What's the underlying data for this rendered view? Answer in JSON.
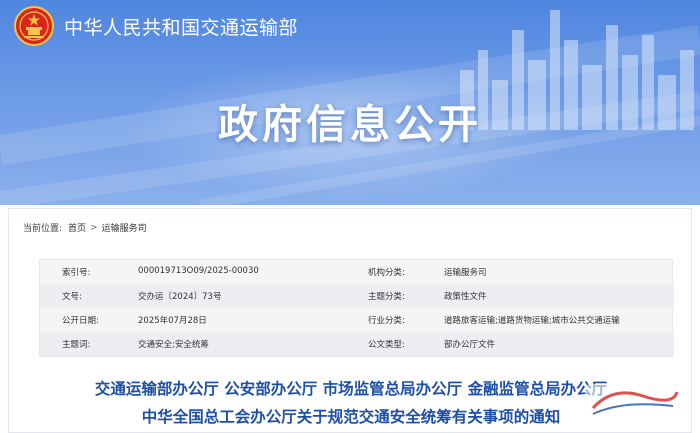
{
  "header": {
    "ministry_name": "中华人民共和国交通运输部",
    "portal_title": "政府信息公开"
  },
  "breadcrumb": {
    "prefix": "当前位置:",
    "items": [
      "首页",
      "运输服务司"
    ],
    "separator": ">"
  },
  "metadata": [
    {
      "label": "索引号:",
      "value": "000019713O09/2025-00030",
      "label2": "机构分类:",
      "value2": "运输服务司"
    },
    {
      "label": "文号:",
      "value": "交办运〔2024〕73号",
      "label2": "主题分类:",
      "value2": "政策性文件"
    },
    {
      "label": "公开日期:",
      "value": "2025年07月28日",
      "label2": "行业分类:",
      "value2": "道路旅客运输;道路货物运输;城市公共交通运输"
    },
    {
      "label": "主题词:",
      "value": "交通安全;安全统筹",
      "label2": "公文类型:",
      "value2": "部办公厅文件"
    }
  ],
  "document": {
    "title_line1": "交通运输部办公厅 公安部办公厅 市场监管总局办公厅 金融监管总局办公厅",
    "title_line2": "中华全国总工会办公厅关于规范交通安全统筹有关事项的通知"
  },
  "colors": {
    "banner_top": "#4f86df",
    "banner_bottom": "#8bb0ec",
    "title_blue": "#1d4fa8"
  }
}
